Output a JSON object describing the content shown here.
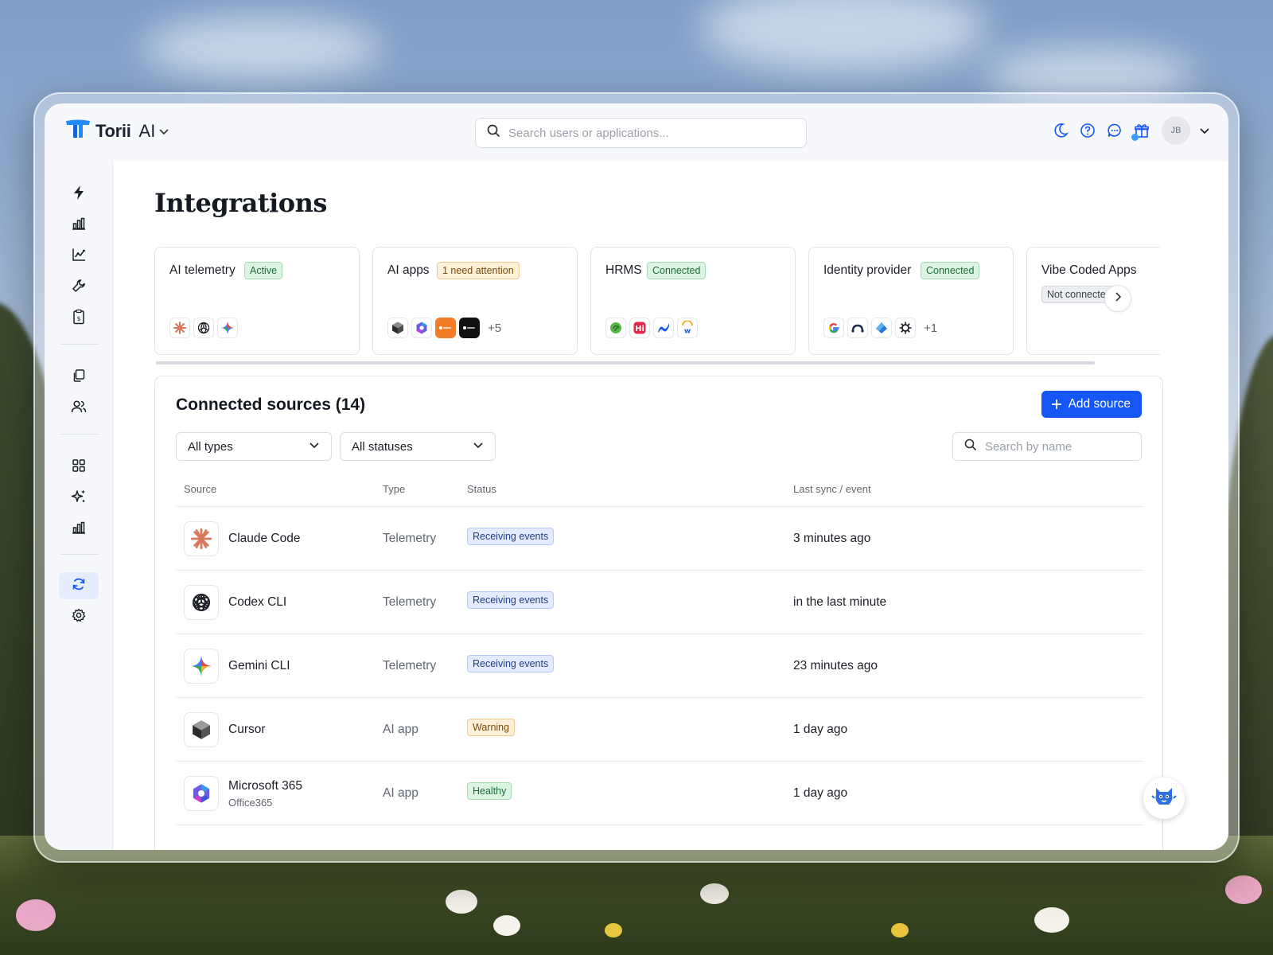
{
  "brand": {
    "name": "Torii",
    "product": "AI"
  },
  "search": {
    "placeholder": "Search users or applications..."
  },
  "user": {
    "initials": "JB"
  },
  "page": {
    "title": "Integrations"
  },
  "cards": [
    {
      "title": "AI telemetry",
      "badge": "Active",
      "badge_style": "green",
      "icons": [
        "claude-icon",
        "openai-icon",
        "gemini-icon"
      ],
      "more": ""
    },
    {
      "title": "AI apps",
      "badge": "1 need attention",
      "badge_style": "orange",
      "icons": [
        "cursor-icon",
        "m365-icon",
        "orange-app-icon",
        "black-app-icon"
      ],
      "more": "+5"
    },
    {
      "title": "HRMS",
      "badge": "Connected",
      "badge_style": "green",
      "icons": [
        "green-leaf-icon",
        "hi-bob-icon",
        "blue-wave-icon",
        "workday-icon"
      ],
      "more": ""
    },
    {
      "title": "Identity provider",
      "badge": "Connected",
      "badge_style": "green",
      "icons": [
        "google-icon",
        "arc-icon",
        "azure-icon",
        "okta-icon"
      ],
      "more": "+1"
    },
    {
      "title": "Vibe Coded Apps",
      "badge": "Not connected",
      "badge_style": "grey",
      "icons": [],
      "more": ""
    }
  ],
  "sources": {
    "title": "Connected sources (14)",
    "add_label": "Add source",
    "filter_type": "All types",
    "filter_status": "All statuses",
    "search_placeholder": "Search by name",
    "columns": {
      "source": "Source",
      "type": "Type",
      "status": "Status",
      "last_sync": "Last sync / event"
    },
    "rows": [
      {
        "name": "Claude Code",
        "sub": "",
        "type": "Telemetry",
        "status": "Receiving events",
        "status_style": "blue",
        "last_sync": "3 minutes ago",
        "icon": "claude-icon"
      },
      {
        "name": "Codex CLI",
        "sub": "",
        "type": "Telemetry",
        "status": "Receiving events",
        "status_style": "blue",
        "last_sync": "in the last minute",
        "icon": "openai-icon"
      },
      {
        "name": "Gemini CLI",
        "sub": "",
        "type": "Telemetry",
        "status": "Receiving events",
        "status_style": "blue",
        "last_sync": "23 minutes ago",
        "icon": "gemini-icon"
      },
      {
        "name": "Cursor",
        "sub": "",
        "type": "AI app",
        "status": "Warning",
        "status_style": "orange",
        "last_sync": "1 day ago",
        "icon": "cursor-icon"
      },
      {
        "name": "Microsoft 365",
        "sub": "Office365",
        "type": "AI app",
        "status": "Healthy",
        "status_style": "green",
        "last_sync": "1 day ago",
        "icon": "m365-icon"
      }
    ]
  },
  "colors": {
    "accent": "#1557f5",
    "brand_blue": "#1f8bff",
    "active_nav": "#e5edff"
  },
  "sidebar": {
    "items": [
      "bolt-icon",
      "bar-chart-icon",
      "trend-chart-icon",
      "wrench-icon",
      "budget-clipboard-icon",
      "copy-icon",
      "users-icon",
      "grid-icon",
      "sparkle-icon",
      "report-chart-icon",
      "sync-icon",
      "gear-icon"
    ],
    "active": "sync-icon"
  }
}
